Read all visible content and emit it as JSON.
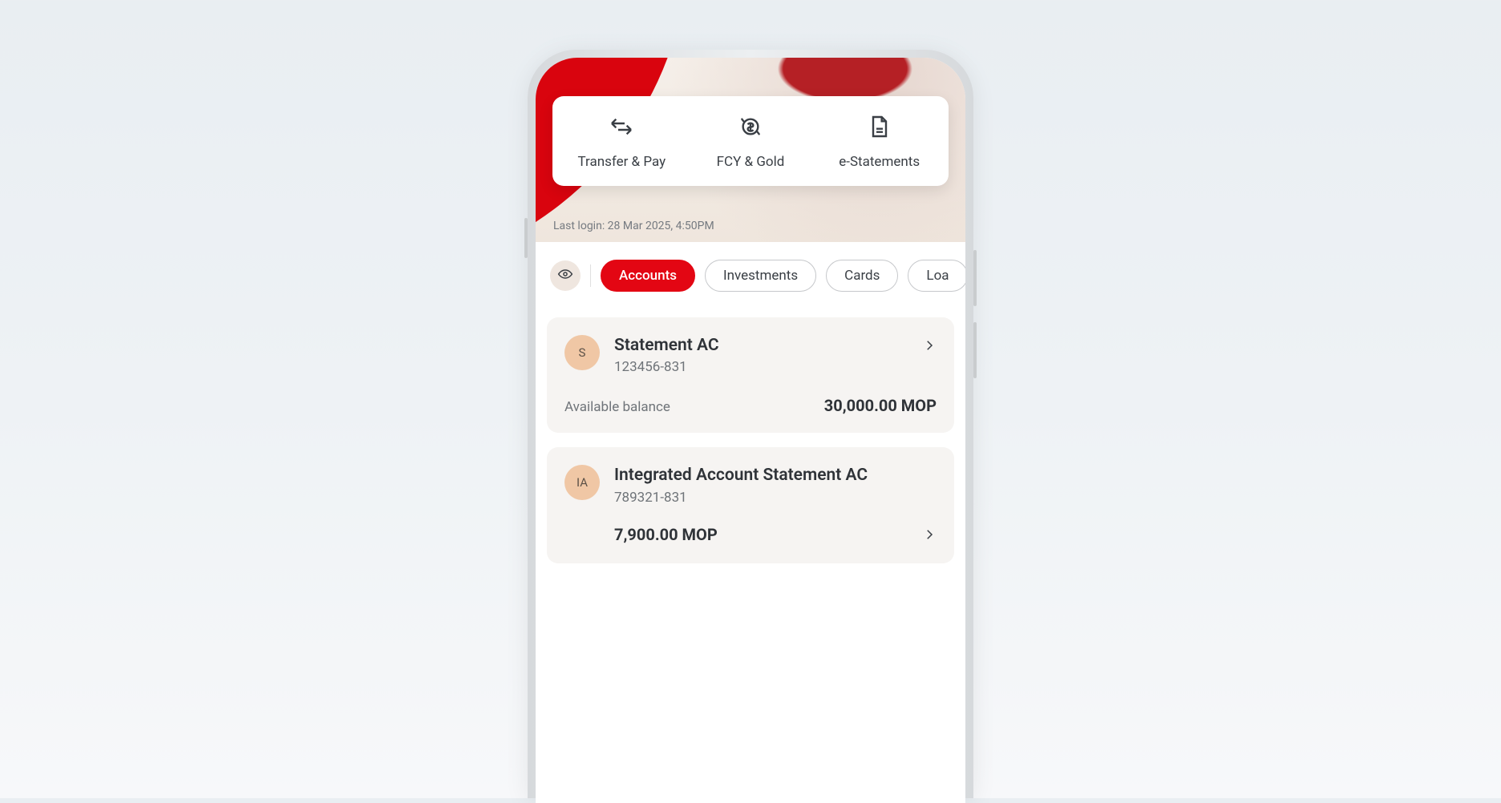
{
  "quickActions": [
    {
      "label": "Transfer & Pay"
    },
    {
      "label": "FCY & Gold"
    },
    {
      "label": "e-Statements"
    }
  ],
  "lastLogin": "Last login: 28 Mar 2025, 4:50PM",
  "tabs": [
    {
      "label": "Accounts",
      "active": true
    },
    {
      "label": "Investments",
      "active": false
    },
    {
      "label": "Cards",
      "active": false
    },
    {
      "label": "Loa",
      "active": false
    }
  ],
  "accounts": [
    {
      "initial": "S",
      "name": "Statement AC",
      "number": "123456-831",
      "balanceLabel": "Available balance",
      "balance": "30,000.00 MOP"
    },
    {
      "initial": "IA",
      "name": "Integrated Account Statement AC",
      "number": "789321-831",
      "balance": "7,900.00 MOP"
    }
  ],
  "colors": {
    "brandRed": "#e30613",
    "avatarPeach": "#f0c7a5"
  }
}
